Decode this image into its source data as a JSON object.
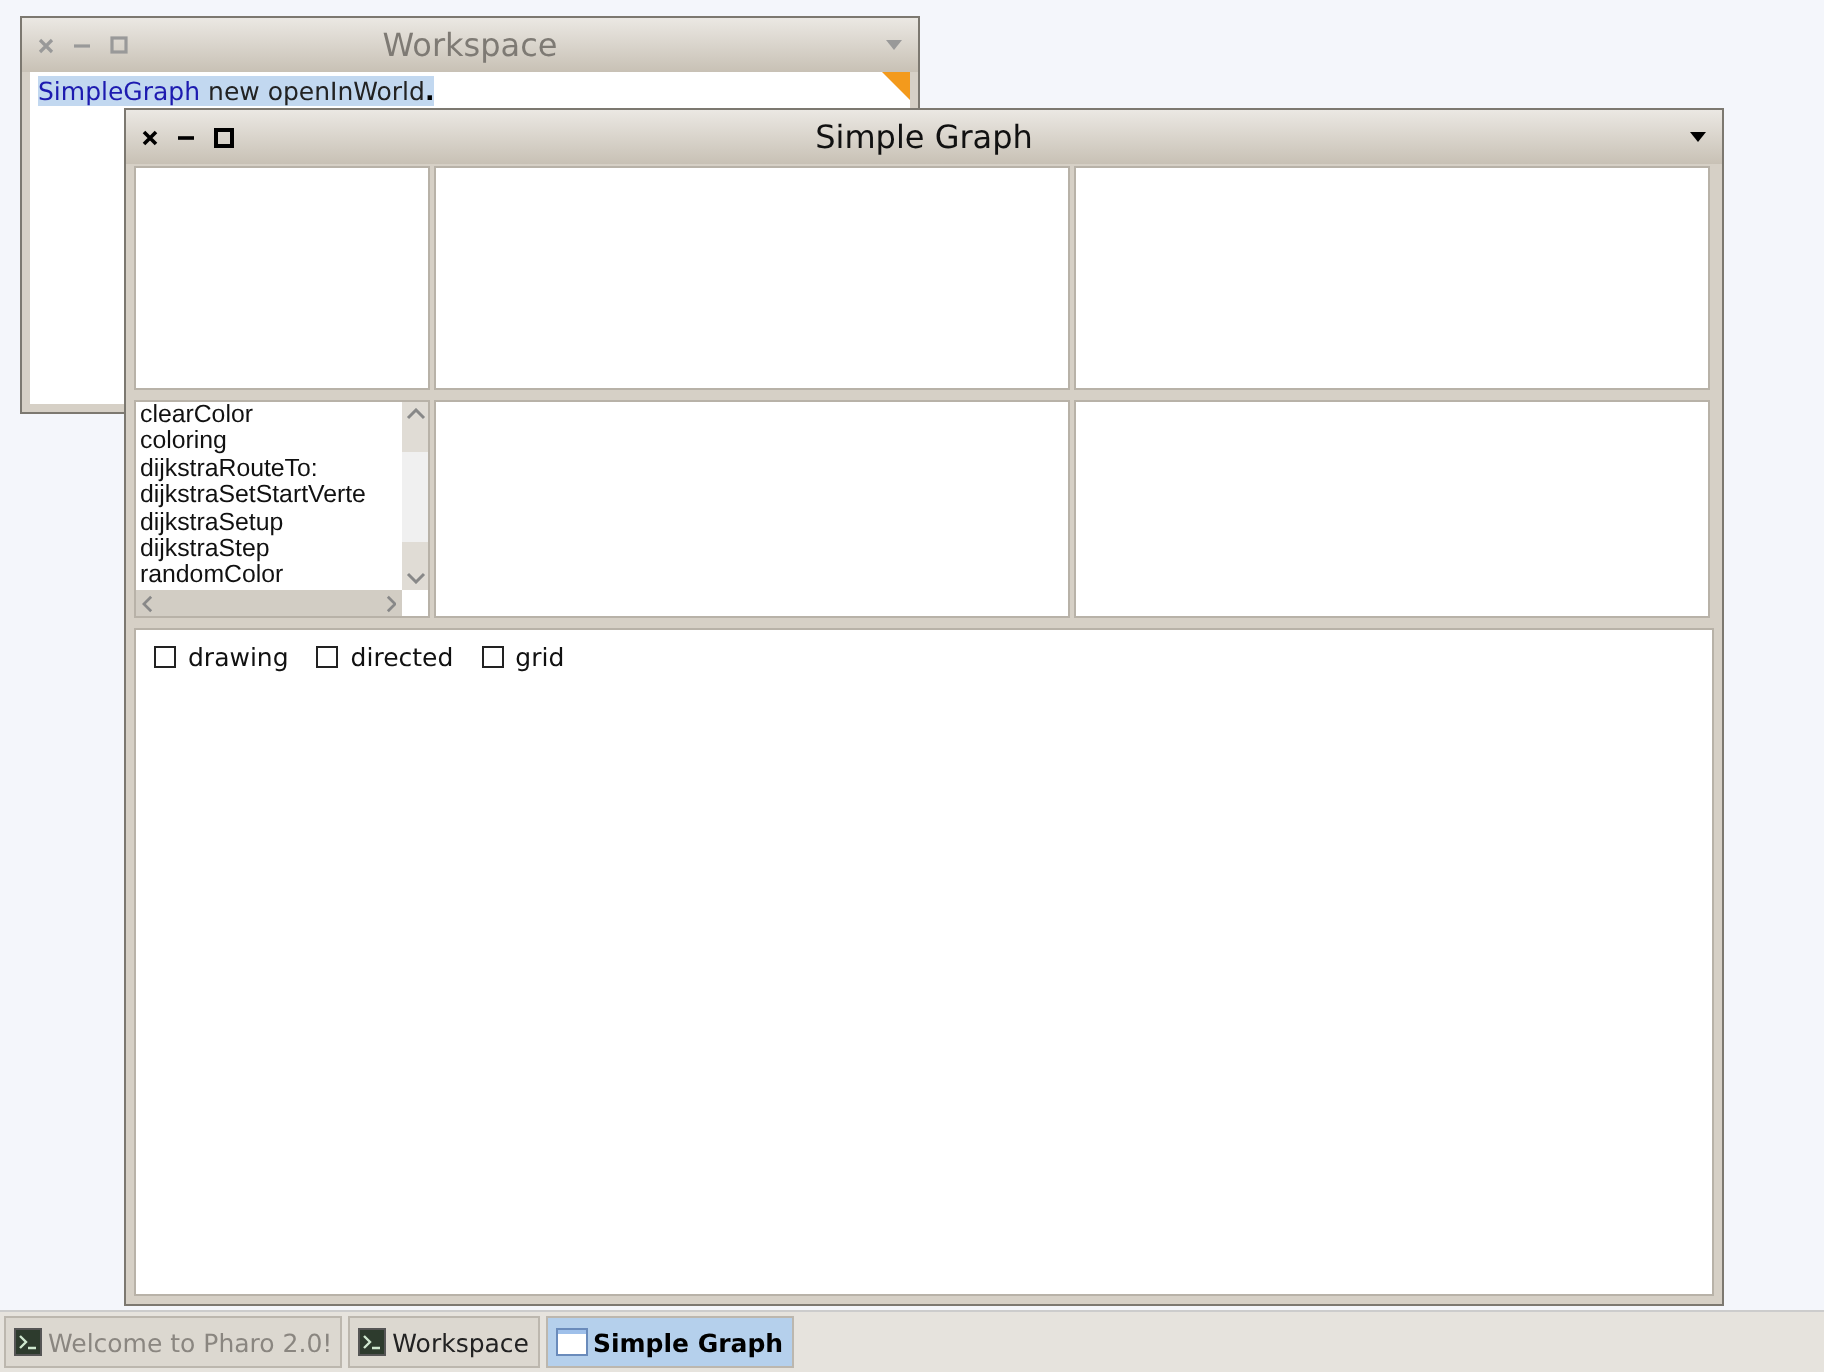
{
  "workspace": {
    "title": "Workspace",
    "active": false,
    "code": [
      {
        "text": "SimpleGraph",
        "kind": "class"
      },
      {
        "text": "new openInWorld",
        "kind": "message"
      },
      {
        "text": ".",
        "kind": "period"
      }
    ],
    "selected": true
  },
  "simple_graph": {
    "title": "Simple Graph",
    "active": true,
    "method_list": [
      "clearColor",
      "coloring",
      "dijkstraRouteTo:",
      "dijkstraSetStartVerte",
      "dijkstraSetup",
      "dijkstraStep",
      "randomColor"
    ],
    "options": [
      {
        "label": "drawing",
        "checked": false
      },
      {
        "label": "directed",
        "checked": false
      },
      {
        "label": "grid",
        "checked": false
      }
    ]
  },
  "taskbar": [
    {
      "label": "Welcome to Pharo 2.0!",
      "kind": "tool",
      "selected": false,
      "dimmed": true
    },
    {
      "label": "Workspace",
      "kind": "tool",
      "selected": false,
      "dimmed": false
    },
    {
      "label": "Simple Graph",
      "kind": "window",
      "selected": true,
      "dimmed": false
    }
  ]
}
